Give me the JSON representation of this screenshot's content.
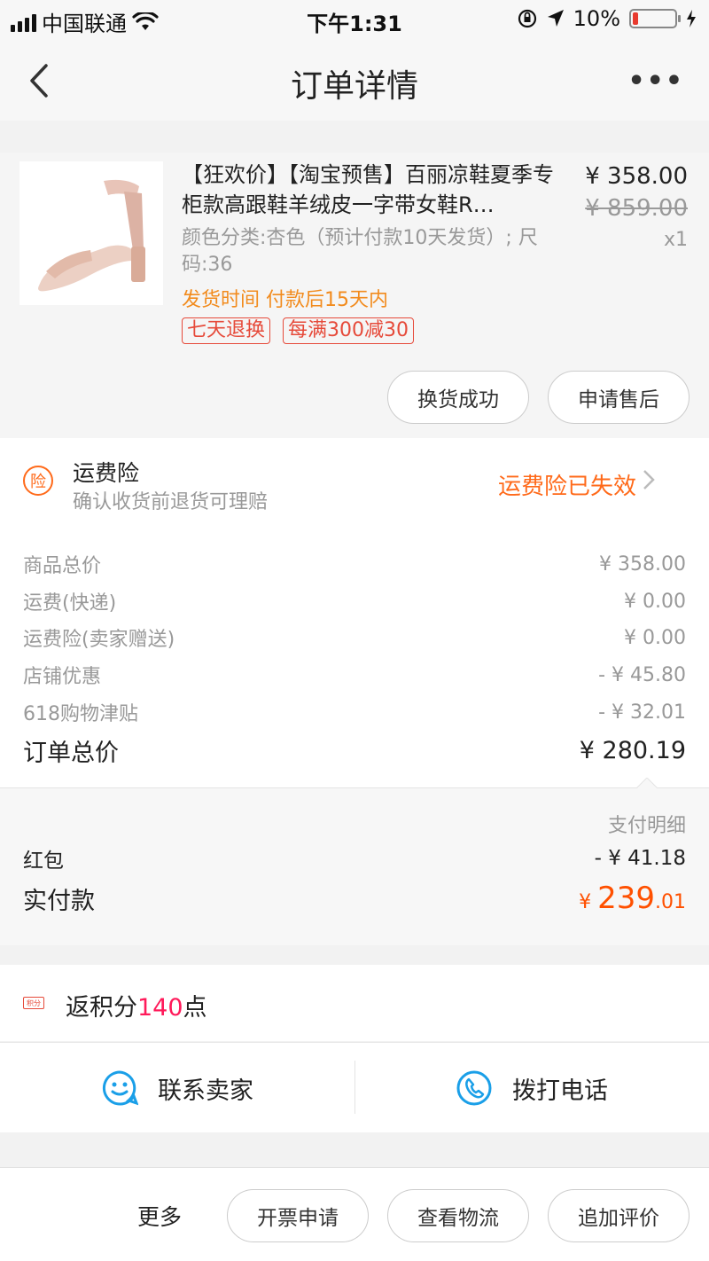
{
  "status_bar": {
    "carrier": "中国联通",
    "time": "下午1:31",
    "battery": "10%"
  },
  "nav": {
    "title": "订单详情",
    "more": "•••"
  },
  "product": {
    "title": "【狂欢价】【淘宝预售】百丽凉鞋夏季专柜款高跟鞋羊绒皮一字带女鞋R…",
    "price": "¥ 358.00",
    "original_price": "¥ 859.00",
    "quantity": "x1",
    "sku": "颜色分类:杏色（预计付款10天发货）; 尺码:36",
    "shipping_time": "发货时间  付款后15天内",
    "tags": [
      "七天退换",
      "每满300减30"
    ],
    "buttons": {
      "exchange_success": "换货成功",
      "apply_after_sale": "申请售后"
    }
  },
  "insurance": {
    "badge": "险",
    "title": "运费险",
    "subtitle": "确认收货前退货可理赔",
    "status": "运费险已失效"
  },
  "price_list": {
    "rows": [
      {
        "label": "商品总价",
        "value": "¥ 358.00"
      },
      {
        "label": "运费(快递)",
        "value": "¥ 0.00"
      },
      {
        "label": "运费险(卖家赠送)",
        "value": "¥ 0.00"
      },
      {
        "label": "店铺优惠",
        "value": "- ¥ 45.80"
      },
      {
        "label": "618购物津贴",
        "value": "- ¥ 32.01"
      }
    ],
    "total_label": "订单总价",
    "total_value": "¥ 280.19"
  },
  "payment": {
    "detail_label": "支付明细",
    "red_packet_label": "红包",
    "red_packet_value": "- ¥ 41.18",
    "paid_label": "实付款",
    "paid_currency": "¥ ",
    "paid_int": "239",
    "paid_dec": ".01"
  },
  "points": {
    "icon_text": "积分",
    "prefix": "返积分",
    "amount": "140",
    "suffix": "点"
  },
  "contact": {
    "seller": "联系卖家",
    "call": "拨打电话"
  },
  "bottom": {
    "more": "更多",
    "invoice": "开票申请",
    "logistics": "查看物流",
    "review": "追加评价"
  },
  "colors": {
    "accent_orange": "#ff5000",
    "tag_red": "#e64a3a",
    "contact_blue": "#1a9fe8"
  }
}
